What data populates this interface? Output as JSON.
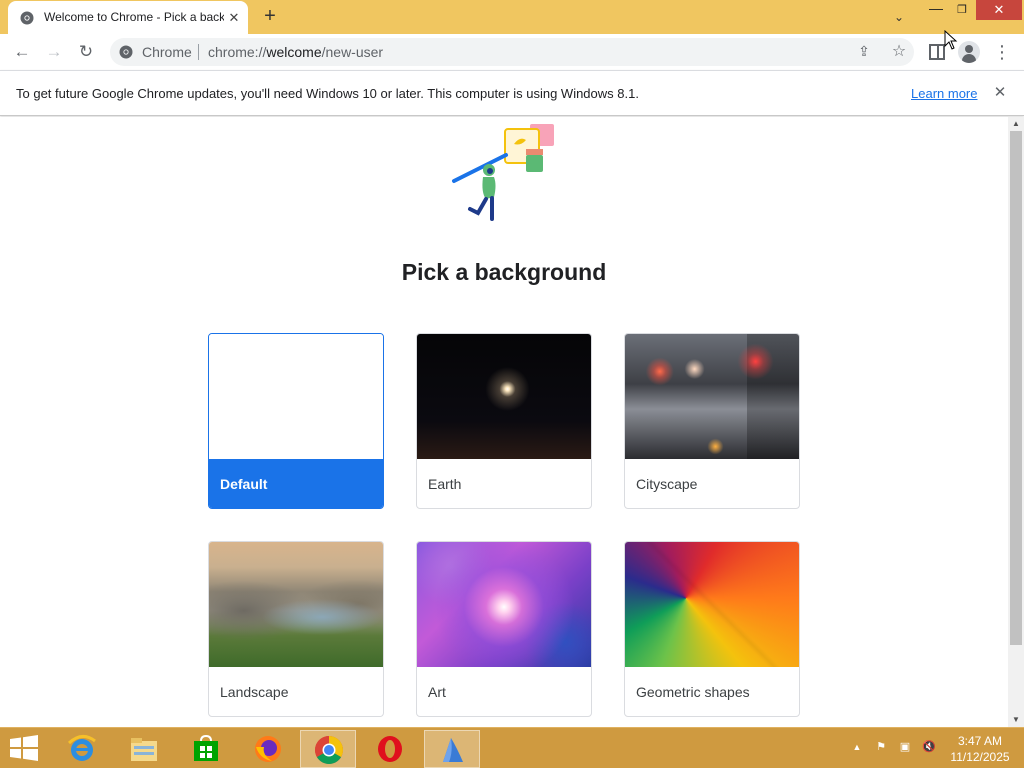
{
  "browser": {
    "tab_title": "Welcome to Chrome - Pick a background",
    "tab_close_glyph": "✕",
    "new_tab_glyph": "+",
    "tab_search_glyph": "⌄",
    "window_minimize_glyph": "—",
    "window_restore_glyph": "❐",
    "window_close_glyph": "✕"
  },
  "toolbar": {
    "back_glyph": "←",
    "forward_glyph": "→",
    "reload_glyph": "↻",
    "omnibox_chip": "Chrome",
    "url_prefix": "chrome://",
    "url_host": "welcome",
    "url_path": "/new-user",
    "share_glyph": "⇪",
    "bookmark_glyph": "☆",
    "menu_glyph": "⋮"
  },
  "infobar": {
    "message": "To get future Google Chrome updates, you'll need Windows 10 or later. This computer is using Windows 8.1.",
    "link_label": "Learn more",
    "close_glyph": "✕"
  },
  "page": {
    "heading": "Pick a background",
    "backgrounds": [
      {
        "label": "Default",
        "selected": true
      },
      {
        "label": "Earth",
        "selected": false
      },
      {
        "label": "Cityscape",
        "selected": false
      },
      {
        "label": "Landscape",
        "selected": false
      },
      {
        "label": "Art",
        "selected": false
      },
      {
        "label": "Geometric shapes",
        "selected": false
      }
    ]
  },
  "scrollbar": {
    "up_glyph": "▲",
    "down_glyph": "▼"
  },
  "taskbar": {
    "apps": [
      {
        "name": "internet-explorer-icon"
      },
      {
        "name": "file-explorer-icon"
      },
      {
        "name": "store-icon"
      },
      {
        "name": "firefox-icon"
      },
      {
        "name": "chrome-icon",
        "active": true
      },
      {
        "name": "opera-icon"
      },
      {
        "name": "app-icon",
        "active": true
      }
    ],
    "tray": {
      "show_hidden_glyph": "▲",
      "flag_glyph": "⚑",
      "network_glyph": "▣",
      "volume_glyph": "🔇"
    },
    "clock_time": "3:47 AM",
    "clock_date": "11/12/2025"
  },
  "colors": {
    "title_bar": "#f0c660",
    "accent": "#1a73e8",
    "taskbar": "#cf9a40",
    "close_button": "#c7463d"
  }
}
